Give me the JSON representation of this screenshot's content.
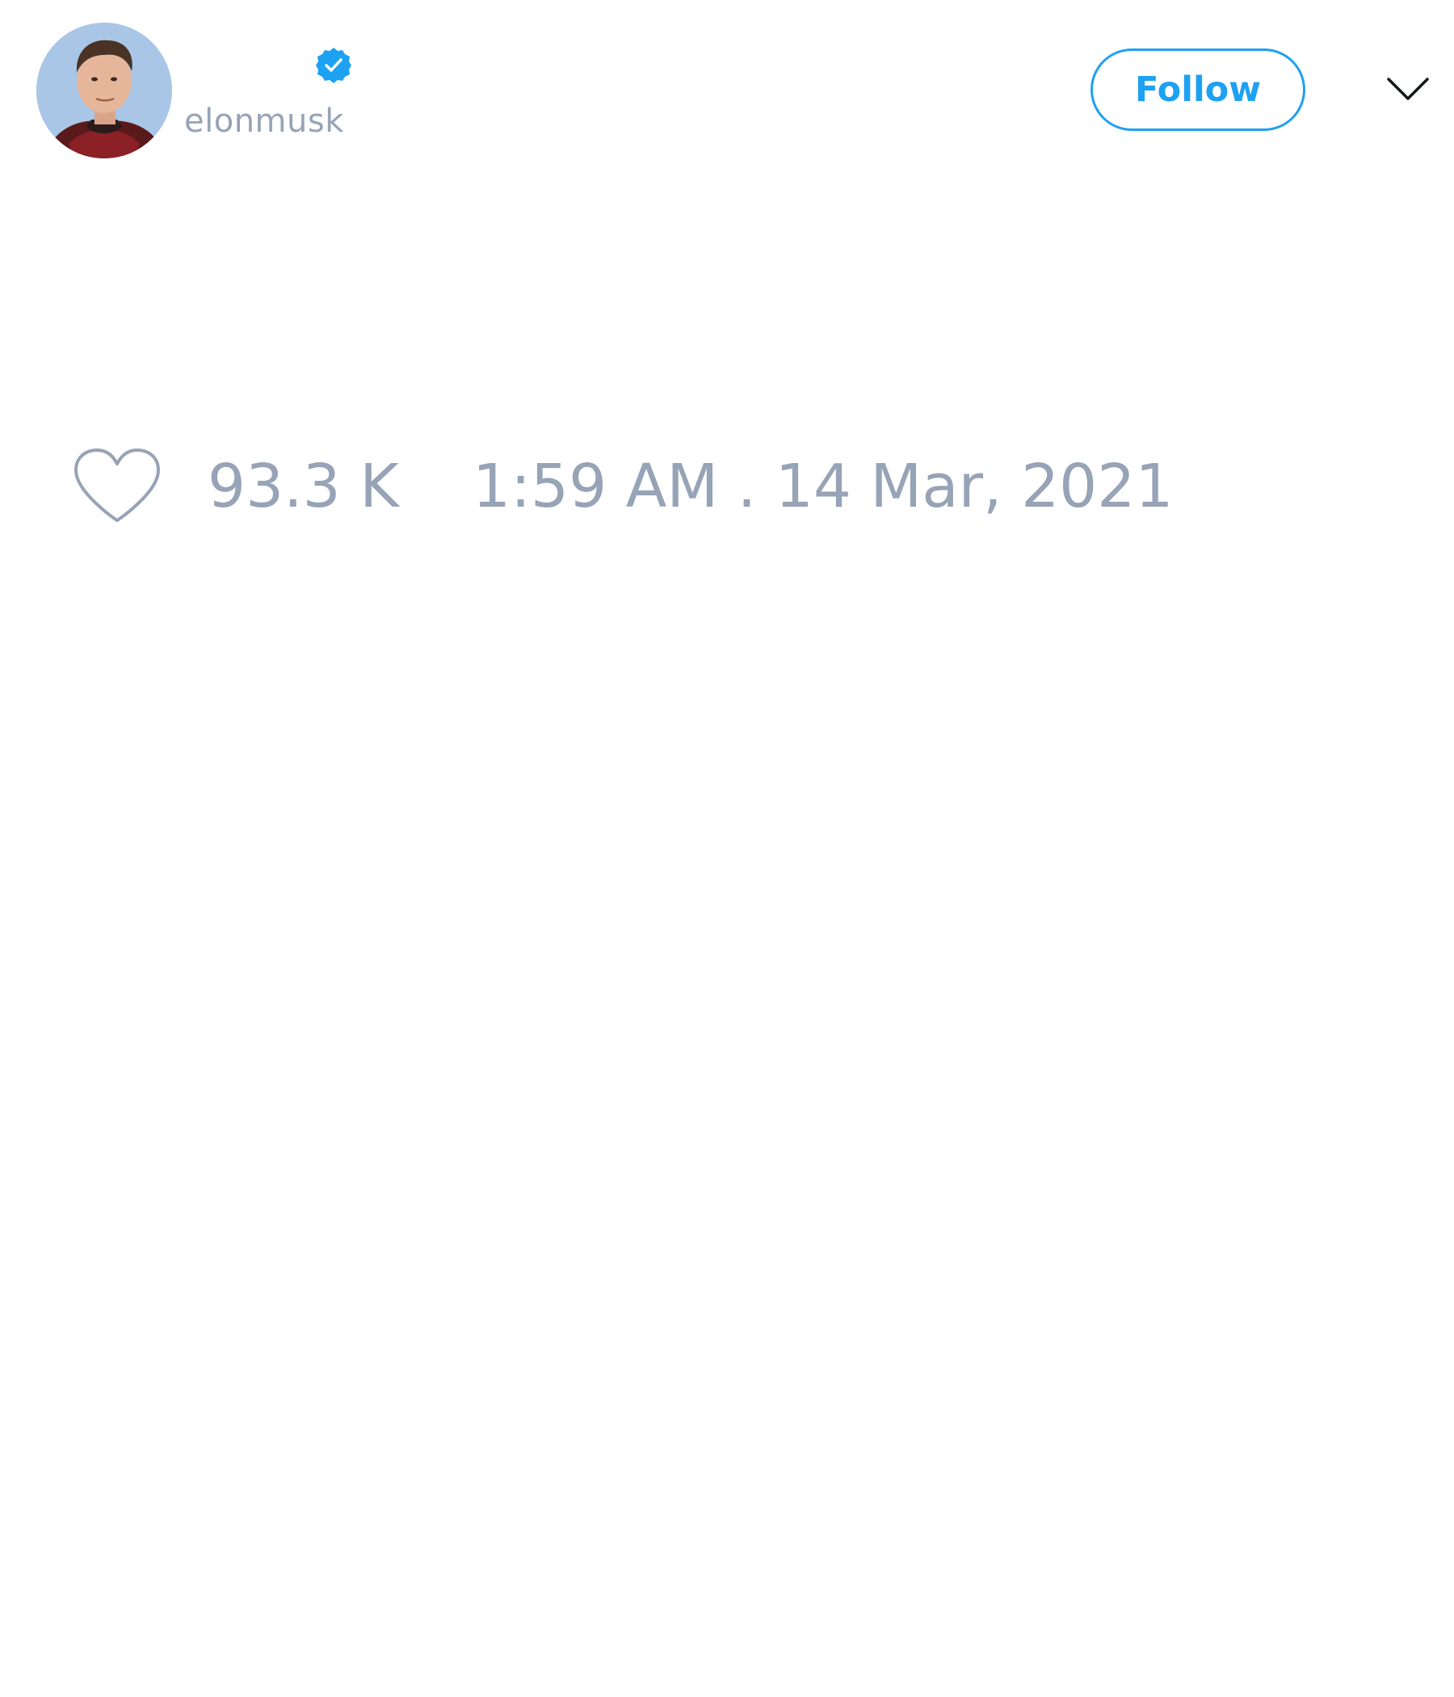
{
  "tweet": {
    "author": {
      "username": "elonmusk",
      "verified": true,
      "verified_icon": "verified-badge-icon",
      "avatar_icon": "profile-photo"
    },
    "follow_label": "Follow",
    "more_icon": "chevron-down-icon",
    "likes": {
      "icon": "heart-icon",
      "count": "93.3 K"
    },
    "timestamp": "1:59 AM . 14 Mar, 2021"
  },
  "colors": {
    "accent": "#1da1f2",
    "muted_text": "#97a3b6",
    "background": "#ffffff"
  }
}
